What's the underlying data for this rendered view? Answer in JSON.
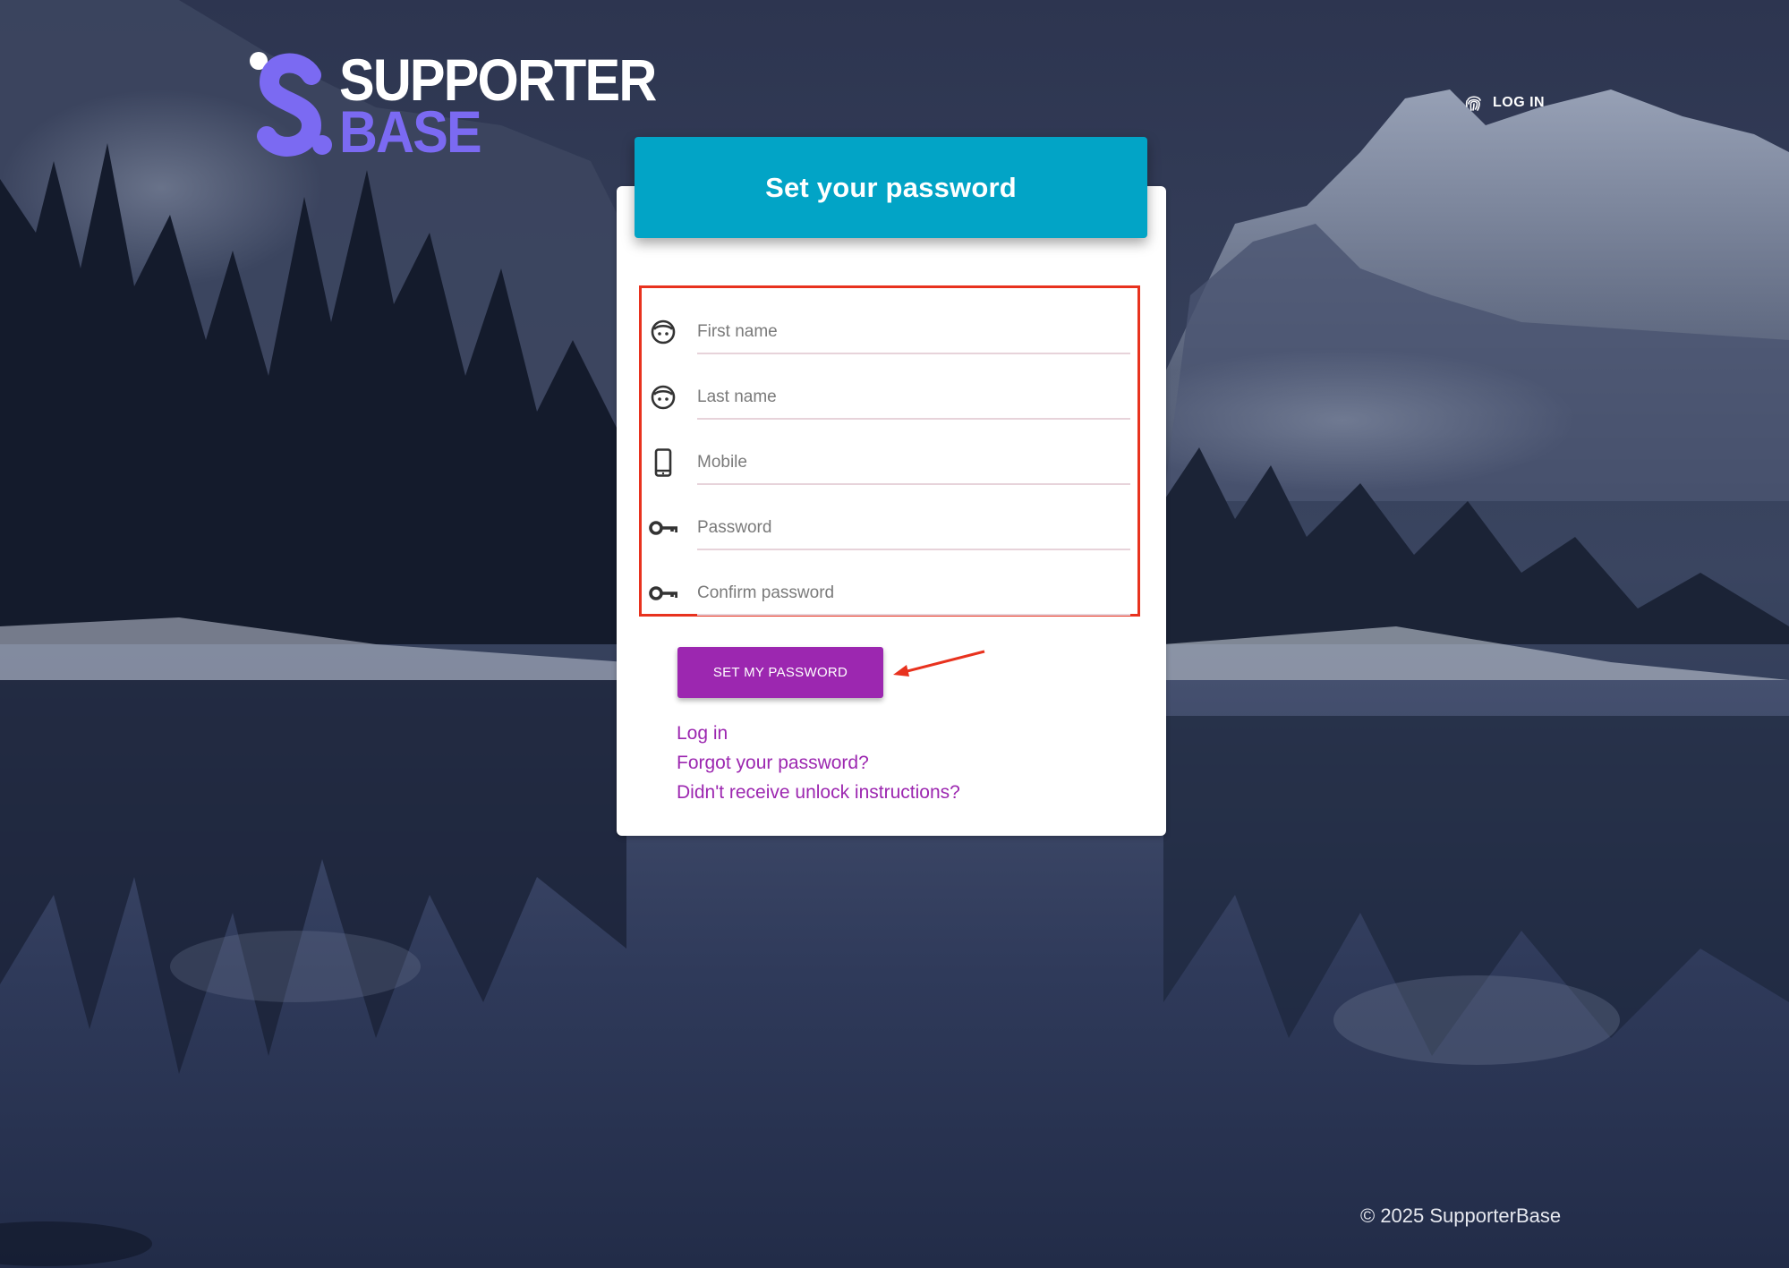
{
  "brand": {
    "logo_line1": "SUPPORTER",
    "logo_line2": "BASE",
    "accent_color": "#7b6af2"
  },
  "nav": {
    "login_label": "LOG IN",
    "login_icon": "fingerprint-icon"
  },
  "form": {
    "title": "Set your password",
    "header_color": "#02a4c6",
    "fields": [
      {
        "placeholder": "First name",
        "value": "",
        "icon": "face-icon"
      },
      {
        "placeholder": "Last name",
        "value": "",
        "icon": "face-icon"
      },
      {
        "placeholder": "Mobile",
        "value": "",
        "icon": "smartphone-icon"
      },
      {
        "placeholder": "Password",
        "value": "",
        "icon": "key-icon"
      },
      {
        "placeholder": "Confirm password",
        "value": "",
        "icon": "key-icon"
      }
    ],
    "submit_label": "SET MY PASSWORD",
    "submit_color": "#9c27b0",
    "annotation_color": "#e8321e"
  },
  "links": {
    "login": "Log in",
    "forgot": "Forgot your password?",
    "unlock": "Didn't receive unlock instructions?"
  },
  "footer": {
    "copyright": "© 2025 SupporterBase"
  }
}
